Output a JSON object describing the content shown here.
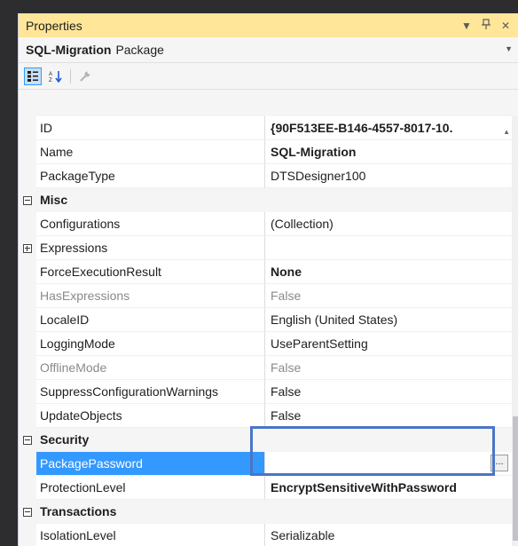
{
  "window": {
    "title": "Properties"
  },
  "object_selector": {
    "name": "SQL-Migration",
    "type": "Package"
  },
  "toolbar": {
    "categorized_icon": "categorized-icon",
    "alphabetical_icon": "alphabetical-icon",
    "property_pages_icon": "wrench-icon"
  },
  "rows": {
    "id": {
      "name": "ID",
      "value": "{90F513EE-B146-4557-8017-10."
    },
    "name": {
      "name": "Name",
      "value": "SQL-Migration"
    },
    "packagetype": {
      "name": "PackageType",
      "value": "DTSDesigner100"
    },
    "cat_misc": {
      "label": "Misc"
    },
    "configurations": {
      "name": "Configurations",
      "value": "(Collection)"
    },
    "expressions": {
      "name": "Expressions",
      "value": ""
    },
    "forceexec": {
      "name": "ForceExecutionResult",
      "value": "None"
    },
    "hasexpr": {
      "name": "HasExpressions",
      "value": "False"
    },
    "localeid": {
      "name": "LocaleID",
      "value": "English (United States)"
    },
    "logging": {
      "name": "LoggingMode",
      "value": "UseParentSetting"
    },
    "offline": {
      "name": "OfflineMode",
      "value": "False"
    },
    "suppress": {
      "name": "SuppressConfigurationWarnings",
      "value": "False"
    },
    "update": {
      "name": "UpdateObjects",
      "value": "False"
    },
    "cat_security": {
      "label": "Security"
    },
    "pkgpassword": {
      "name": "PackagePassword",
      "value": "",
      "button": "..."
    },
    "protection": {
      "name": "ProtectionLevel",
      "value": "EncryptSensitiveWithPassword"
    },
    "cat_transactions": {
      "label": "Transactions"
    },
    "isolation": {
      "name": "IsolationLevel",
      "value": "Serializable"
    }
  },
  "colors": {
    "title_bar": "#ffe699",
    "selection": "#3399ff",
    "highlight_border": "#4a76c6"
  }
}
